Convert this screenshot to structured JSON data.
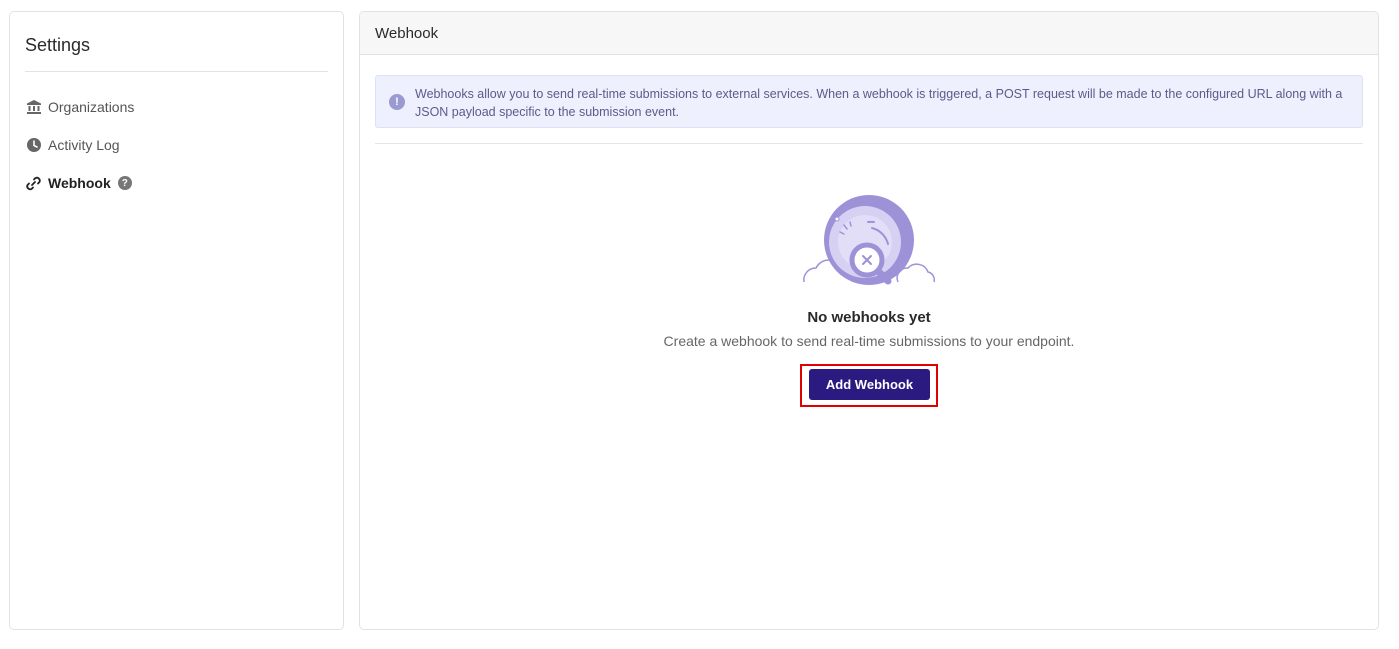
{
  "sidebar": {
    "title": "Settings",
    "items": [
      {
        "label": "Organizations",
        "icon": "bank-icon"
      },
      {
        "label": "Activity Log",
        "icon": "clock-icon"
      },
      {
        "label": "Webhook",
        "icon": "link-icon",
        "active": true,
        "help": "?"
      }
    ]
  },
  "main": {
    "header_title": "Webhook",
    "info_text": "Webhooks allow you to send real-time submissions to external services. When a webhook is triggered, a POST request will be made to the configured URL along with a JSON payload specific to the submission event.",
    "info_icon": "!",
    "empty_state": {
      "title": "No webhooks yet",
      "description": "Create a webhook to send real-time submissions to your endpoint.",
      "button_label": "Add Webhook"
    }
  },
  "colors": {
    "primary_button": "#2b1a7f",
    "info_bg": "#eef0fd",
    "illustration": "#9d92d8",
    "highlight": "#e00000"
  }
}
